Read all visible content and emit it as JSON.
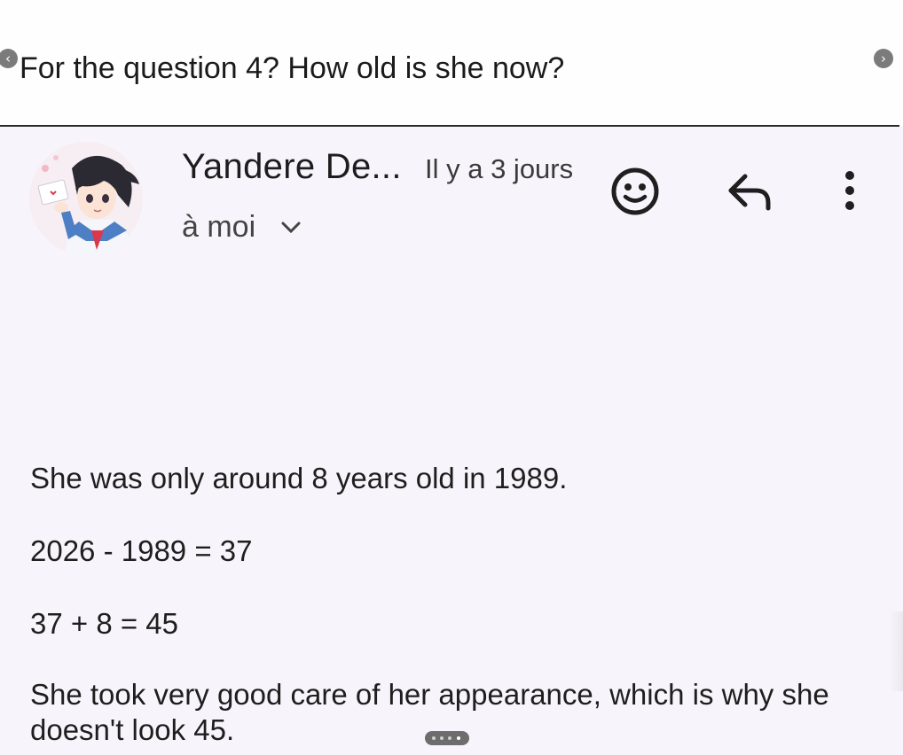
{
  "banner": {
    "text": "For the question 4? How old is she now?"
  },
  "email": {
    "sender": "Yandere De...",
    "timestamp": "Il y a 3 jours",
    "recipient": "à moi",
    "body": [
      "She was only around 8 years old in 1989.",
      "2026 - 1989 = 37",
      "37 + 8 = 45",
      "She took very good care of her appearance, which is why she",
      "doesn't look 45."
    ]
  },
  "icons": {
    "prev": "chevron-left-icon",
    "next": "chevron-right-icon",
    "emoji": "emoji-reaction-icon",
    "reply": "reply-icon",
    "more": "more-vert-icon",
    "expand": "chevron-down-icon"
  },
  "colors": {
    "background": "#f7f5fb",
    "banner_background": "#fefefe",
    "text": "#1f1f1f"
  }
}
